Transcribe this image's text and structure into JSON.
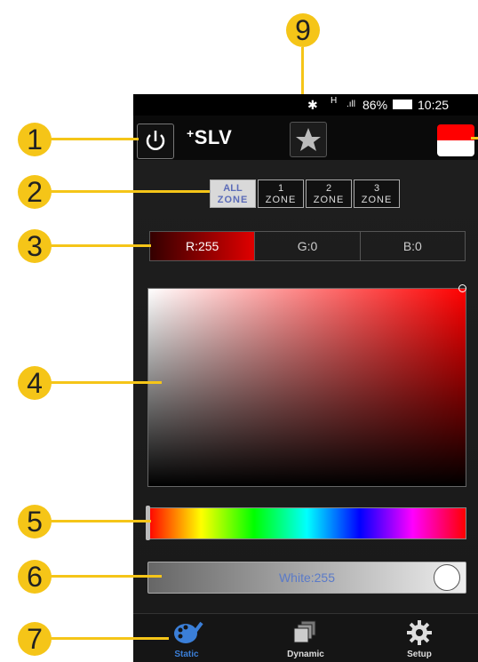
{
  "status_bar": {
    "signal": "H",
    "battery": "86%",
    "time": "10:25"
  },
  "app_bar": {
    "logo": "SLV",
    "logo_prefix": "+"
  },
  "zones": [
    {
      "line1": "ALL",
      "line2": "ZONE",
      "active": true
    },
    {
      "line1": "1",
      "line2": "ZONE",
      "active": false
    },
    {
      "line1": "2",
      "line2": "ZONE",
      "active": false
    },
    {
      "line1": "3",
      "line2": "ZONE",
      "active": false
    }
  ],
  "rgb": {
    "r": "R:255",
    "g": "G:0",
    "b": "B:0"
  },
  "white_slider": {
    "label": "White:255",
    "level": 1.0
  },
  "hue_slider": {
    "level": 0.0
  },
  "tabs": [
    {
      "label": "Static",
      "icon": "palette-icon",
      "active": true
    },
    {
      "label": "Dynamic",
      "icon": "stacked-squares-icon",
      "active": false
    },
    {
      "label": "Setup",
      "icon": "gear-icon",
      "active": false
    }
  ],
  "callouts": [
    "1",
    "2",
    "3",
    "4",
    "5",
    "6",
    "7",
    "9"
  ],
  "colors": {
    "accent": "#f5c518",
    "selected": "#ff0000",
    "tab_active": "#3b7fd8"
  }
}
